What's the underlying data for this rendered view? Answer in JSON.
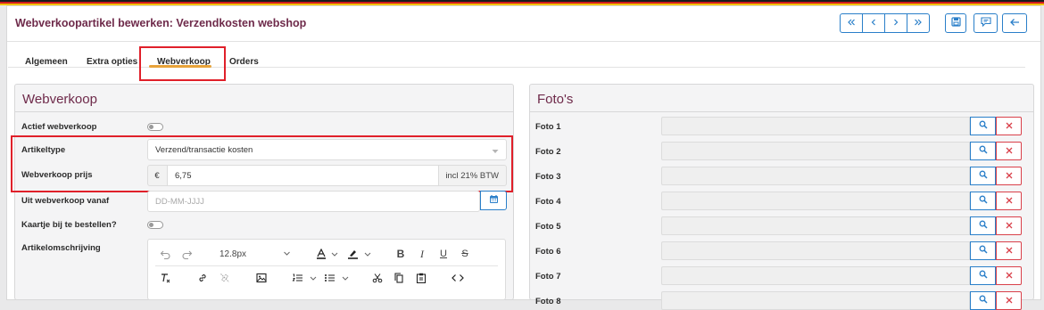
{
  "flag_colors": [
    "#1a1a1a",
    "#d01c1f",
    "#f2c200"
  ],
  "header": {
    "title": "Webverkoopartikel bewerken: Verzendkosten webshop",
    "nav_first": "«",
    "nav_prev": "‹",
    "nav_next": "›",
    "nav_last": "»"
  },
  "tabs": [
    {
      "label": "Algemeen"
    },
    {
      "label": "Extra opties"
    },
    {
      "label": "Webverkoop"
    },
    {
      "label": "Orders"
    }
  ],
  "webverkoop": {
    "title": "Webverkoop",
    "actief_label": "Actief webverkoop",
    "artikeltype_label": "Artikeltype",
    "artikeltype_value": "Verzend/transactie kosten",
    "prijs_label": "Webverkoop prijs",
    "prijs_prefix": "€",
    "prijs_value": "6,75",
    "prijs_suffix": "incl 21% BTW",
    "uit_label": "Uit webverkoop vanaf",
    "uit_placeholder": "DD-MM-JJJJ",
    "kaartje_label": "Kaartje bij te bestellen?",
    "omschrijving_label": "Artikelomschrijving",
    "font_size": "12.8px"
  },
  "fotos": {
    "title": "Foto's",
    "rows": [
      {
        "label": "Foto 1"
      },
      {
        "label": "Foto 2"
      },
      {
        "label": "Foto 3"
      },
      {
        "label": "Foto 4"
      },
      {
        "label": "Foto 5"
      },
      {
        "label": "Foto 6"
      },
      {
        "label": "Foto 7"
      },
      {
        "label": "Foto 8"
      }
    ]
  }
}
